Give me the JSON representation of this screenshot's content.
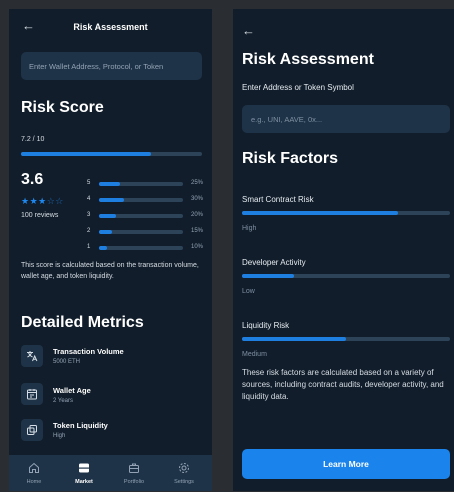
{
  "left": {
    "header": {
      "title": "Risk Assessment",
      "back_icon": "arrow-left-icon"
    },
    "search": {
      "placeholder": "Enter Wallet Address, Protocol, or Token"
    },
    "risk_score": {
      "heading": "Risk Score",
      "score_text": "7.2 / 10",
      "score_fraction": 0.72
    },
    "rating": {
      "value": "3.6",
      "stars": "★★★",
      "stars_empty": "☆☆",
      "reviews": "100 reviews",
      "distribution": [
        {
          "stars": "5",
          "percent": "25%",
          "fraction": 0.25
        },
        {
          "stars": "4",
          "percent": "30%",
          "fraction": 0.3
        },
        {
          "stars": "3",
          "percent": "20%",
          "fraction": 0.2
        },
        {
          "stars": "2",
          "percent": "15%",
          "fraction": 0.15
        },
        {
          "stars": "1",
          "percent": "10%",
          "fraction": 0.1
        }
      ]
    },
    "description": "This score is calculated based on the transaction volume, wallet age, and token liquidity.",
    "metrics": {
      "heading": "Detailed Metrics",
      "items": [
        {
          "title": "Transaction Volume",
          "value": "5000 ETH",
          "icon": "translate-icon"
        },
        {
          "title": "Wallet Age",
          "value": "2 Years",
          "icon": "calendar-icon"
        },
        {
          "title": "Token Liquidity",
          "value": "High",
          "icon": "copy-icon"
        }
      ]
    },
    "nav": {
      "items": [
        {
          "label": "Home",
          "icon": "home-icon"
        },
        {
          "label": "Market",
          "icon": "market-icon"
        },
        {
          "label": "Portfolio",
          "icon": "briefcase-icon"
        },
        {
          "label": "Settings",
          "icon": "gear-icon"
        }
      ],
      "active": "Market"
    }
  },
  "right": {
    "back_icon": "arrow-left-icon",
    "title": "Risk Assessment",
    "input_label": "Enter Address or Token Symbol",
    "input_placeholder": "e.g., UNI, AAVE, 0x...",
    "factors_heading": "Risk Factors",
    "factors": [
      {
        "name": "Smart Contract Risk",
        "level": "High",
        "fraction": 0.75
      },
      {
        "name": "Developer Activity",
        "level": "Low",
        "fraction": 0.25
      },
      {
        "name": "Liquidity Risk",
        "level": "Medium",
        "fraction": 0.5
      }
    ],
    "description": "These risk factors are calculated based on a variety of sources, including contract audits, developer activity, and liquidity data.",
    "button_label": "Learn More"
  },
  "colors": {
    "background": "#2a2d31",
    "panel": "#111d2a",
    "surface": "#1e3347",
    "accent": "#1e7fe0",
    "track": "#2c4358"
  }
}
